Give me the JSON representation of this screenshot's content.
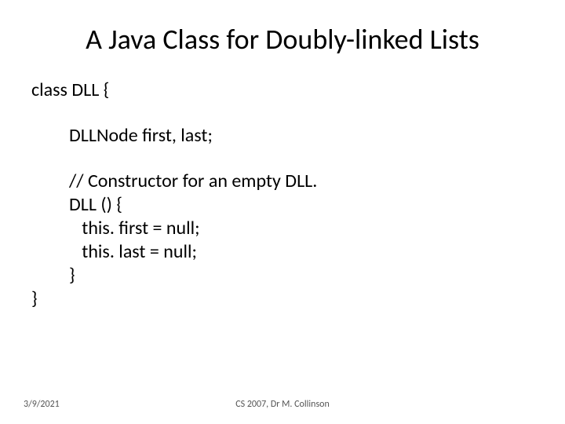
{
  "title": "A Java Class for Doubly-linked Lists",
  "code": {
    "l1": "class DLL {",
    "l2": "DLLNode first, last;",
    "l3": "// Constructor for an empty DLL.",
    "l4": "DLL () {",
    "l5": "   this. first = null;",
    "l6": "   this. last = null;",
    "l7": "}",
    "l8": "}"
  },
  "footer": {
    "date": "3/9/2021",
    "center": "CS 2007,  Dr M. Collinson"
  }
}
